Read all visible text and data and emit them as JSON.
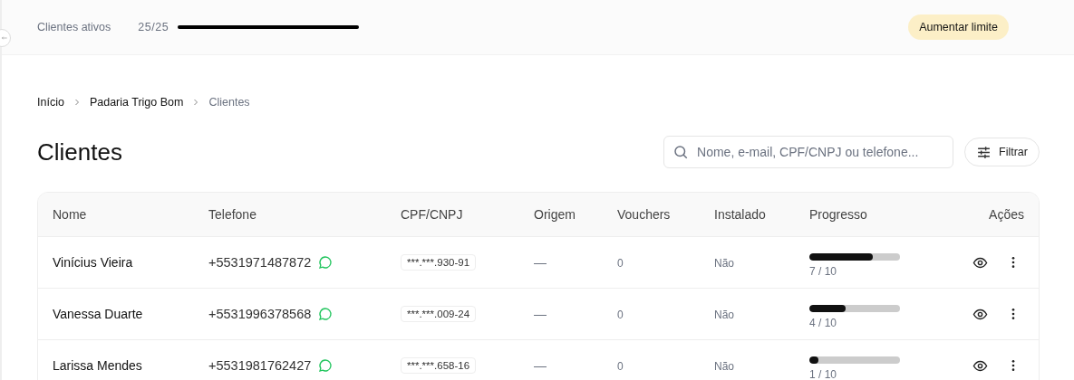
{
  "topbar": {
    "label": "Clientes ativos",
    "count": "25/25",
    "level": 1,
    "button": "Aumentar limite"
  },
  "breadcrumb": [
    {
      "label": "Início",
      "current": false
    },
    {
      "label": "Padaria Trigo Bom",
      "current": false
    },
    {
      "label": "Clientes",
      "current": true
    }
  ],
  "title": "Clientes",
  "search": {
    "placeholder": "Nome, e-mail, CPF/CNPJ ou telefone..."
  },
  "filter_button": "Filtrar",
  "table": {
    "columns": [
      "Nome",
      "Telefone",
      "CPF/CNPJ",
      "Origem",
      "Vouchers",
      "Instalado",
      "Progresso",
      "Ações"
    ],
    "rows": [
      {
        "name": "Vinícius Vieira",
        "phone": "+5531971487872",
        "doc": "***.***.930-91",
        "origin": "—",
        "vouchers": "0",
        "installed": "Não",
        "level": 0.7,
        "progress": "7 / 10"
      },
      {
        "name": "Vanessa Duarte",
        "phone": "+5531996378568",
        "doc": "***.***.009-24",
        "origin": "—",
        "vouchers": "0",
        "installed": "Não",
        "level": 0.4,
        "progress": "4 / 10"
      },
      {
        "name": "Larissa Mendes",
        "phone": "+5531981762427",
        "doc": "***.***.658-16",
        "origin": "—",
        "vouchers": "0",
        "installed": "Não",
        "level": 0.1,
        "progress": "1 / 10"
      }
    ]
  }
}
